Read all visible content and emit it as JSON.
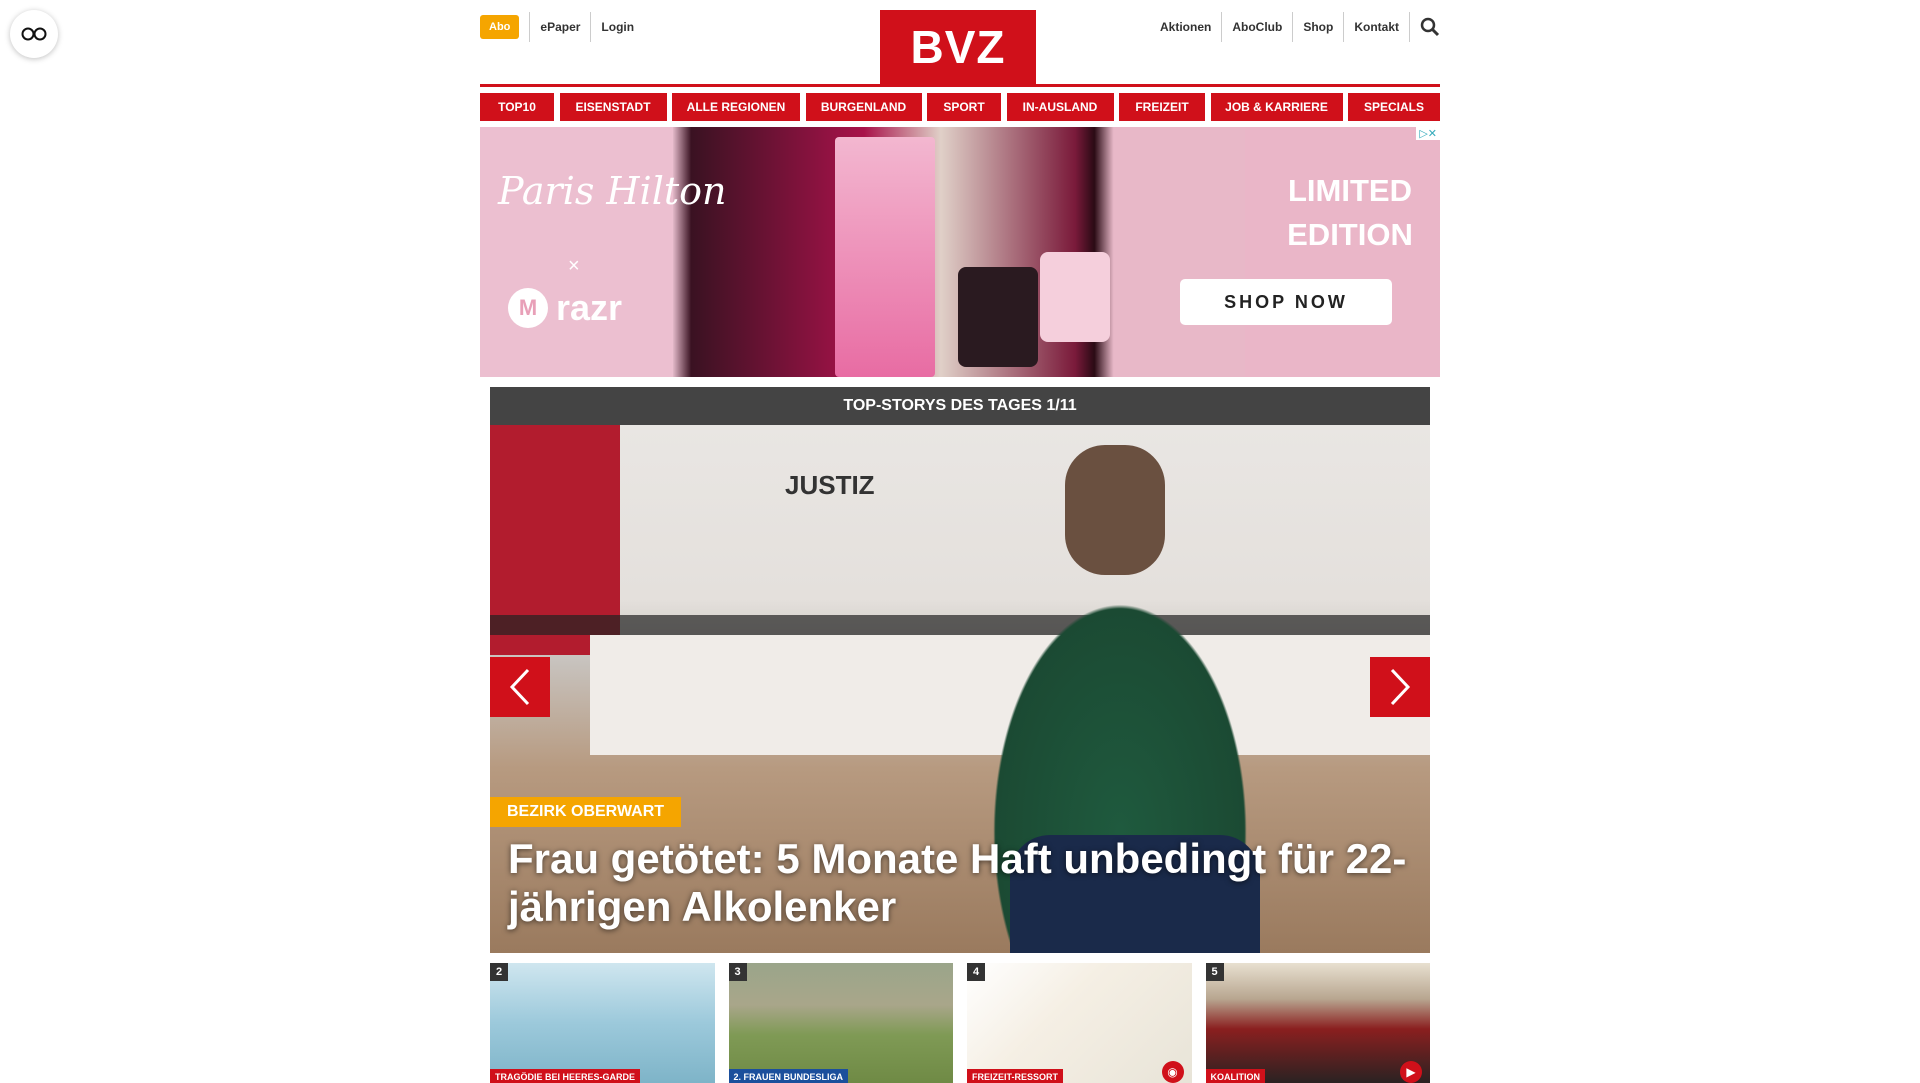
{
  "browser": {
    "reader_icon": "glasses-icon"
  },
  "header": {
    "abo_label": "Abo",
    "left_links": [
      "ePaper",
      "Login"
    ],
    "logo_text": "BVZ",
    "right_links": [
      "Aktionen",
      "AboClub",
      "Shop",
      "Kontakt"
    ],
    "search_icon": "search-icon",
    "brand_color": "#d0101a",
    "accent_color": "#f5a500"
  },
  "main_nav": [
    "TOP10",
    "EISENSTADT",
    "ALLE REGIONEN",
    "BURGENLAND",
    "SPORT",
    "IN-AUSLAND",
    "FREIZEIT",
    "JOB & KARRIERE",
    "SPECIALS"
  ],
  "ad": {
    "brand_1": "Paris Hilton",
    "brand_x": "×",
    "brand_2": "razr",
    "headline_line1": "LIMITED",
    "headline_line2": "EDITION",
    "cta": "SHOP NOW",
    "adchoices": "▷✕"
  },
  "hero": {
    "section_title": "TOP-STORYS DES TAGES 1/11",
    "tag": "BEZIRK OBERWART",
    "headline": "Frau getötet: 5 Monate Haft unbedingt für 22-jährigen Alkolenker",
    "prev_icon": "chevron-left-icon",
    "next_icon": "chevron-right-icon",
    "image_sign": "JUSTIZ"
  },
  "thumbnails": [
    {
      "number": "2",
      "tag": "TRAGÖDIE BEI HEERES-GARDE",
      "color": "red"
    },
    {
      "number": "3",
      "tag": "2. FRAUEN BUNDESLIGA",
      "color": "blue"
    },
    {
      "number": "4",
      "tag": "FREIZEIT-RESSORT",
      "color": "red",
      "icon": "camera-icon"
    },
    {
      "number": "5",
      "tag": "KOALITION",
      "color": "red",
      "icon": "play-icon"
    }
  ]
}
